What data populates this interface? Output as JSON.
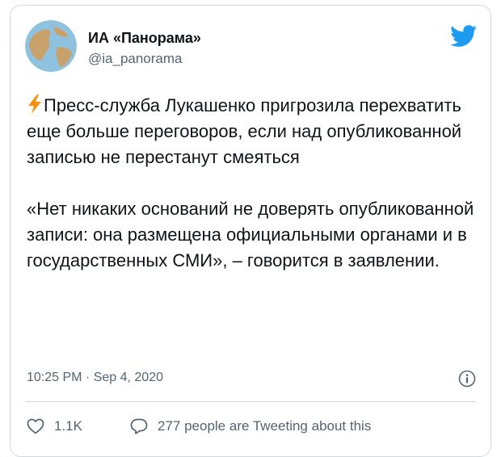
{
  "author": {
    "name": "ИА «Панорама»",
    "handle": "@ia_panorama"
  },
  "tweet": {
    "paragraph_1": "Пресс-служба Лукашенко пригрозила перехватить еще больше переговоров, если над опубликованной записью не перестанут смеяться",
    "paragraph_2": "«Нет никаких оснований не доверять опубликованной записи: она размещена официальными органами и в государственных СМИ», – говорится в заявлении.",
    "timestamp": "10:25 PM · Sep 4, 2020"
  },
  "actions": {
    "likes": "1.1K",
    "conversation": "277 people are Tweeting about this"
  },
  "icons": {
    "brand": "twitter-bird-icon",
    "lead": "lightning-bolt-icon",
    "info": "info-icon",
    "like": "heart-icon",
    "reply": "speech-bubble-icon"
  },
  "colors": {
    "twitter_blue": "#1d9bf0",
    "text_primary": "#0f1419",
    "text_secondary": "#536471",
    "border": "#cfd9de",
    "bolt": "#f4900c"
  }
}
